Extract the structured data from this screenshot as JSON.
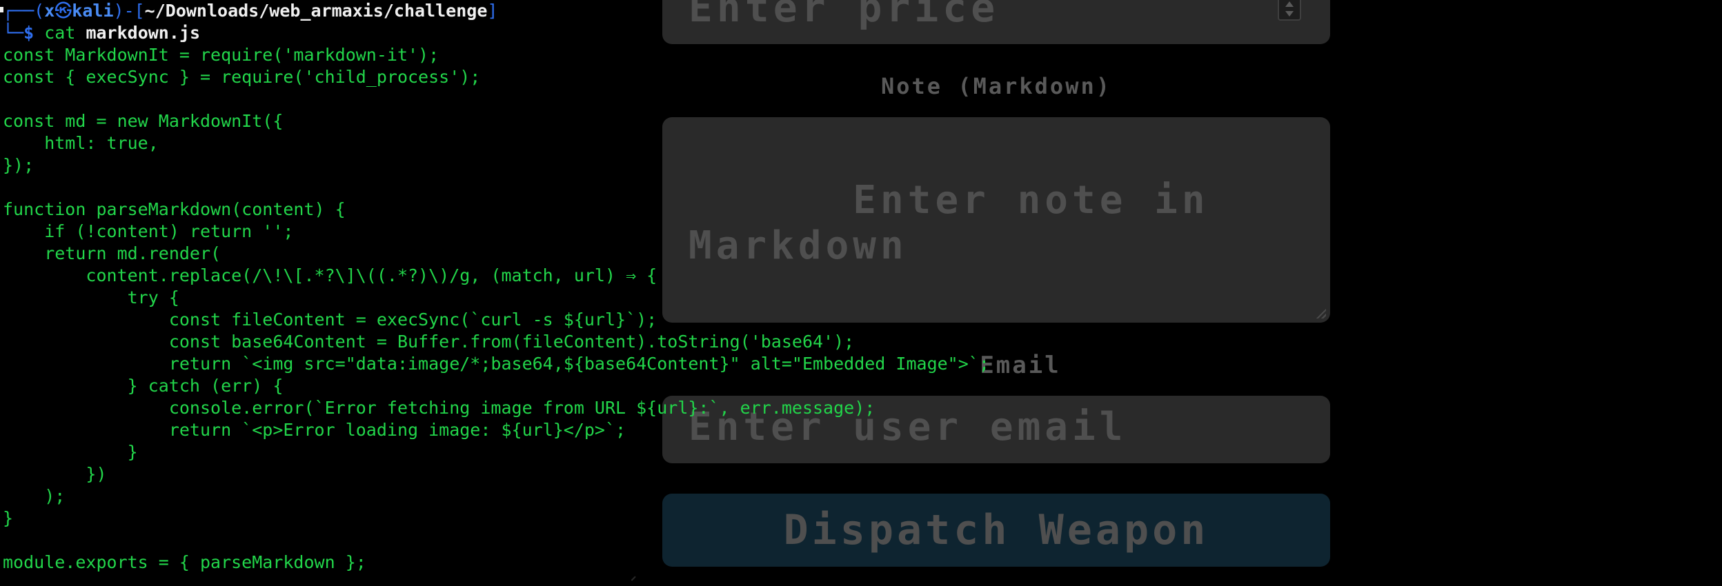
{
  "form": {
    "price_placeholder": "Enter price",
    "note_label": "Note (Markdown)",
    "note_placeholder": "Enter note in\nMarkdown",
    "email_label": "Email",
    "email_placeholder": "Enter user email",
    "submit_label": "Dispatch Weapon"
  },
  "terminal": {
    "prompt": {
      "box_left": "┌──(",
      "user": "x",
      "skull_glyph": "㉿",
      "host": "kali",
      "box_mid": ")-[",
      "path": "~/Downloads/web_armaxis/challenge",
      "box_right": "]",
      "box_bottom": "└─",
      "dollar": "$",
      "command": "cat",
      "argument": "markdown.js"
    },
    "code_lines": [
      "const MarkdownIt = require('markdown-it');",
      "const { execSync } = require('child_process');",
      "",
      "const md = new MarkdownIt({",
      "    html: true,",
      "});",
      "",
      "function parseMarkdown(content) {",
      "    if (!content) return '';",
      "    return md.render(",
      "        content.replace(/\\!\\[.*?\\]\\((.*?)\\)/g, (match, url) ⇒ {",
      "            try {",
      "                const fileContent = execSync(`curl -s ${url}`);",
      "                const base64Content = Buffer.from(fileContent).toString('base64');",
      "                return `<img src=\"data:image/*;base64,${base64Content}\" alt=\"Embedded Image\">`;",
      "            } catch (err) {",
      "                console.error(`Error fetching image from URL ${url}:`, err.message);",
      "                return `<p>Error loading image: ${url}</p>`;",
      "            }",
      "        })",
      "    );",
      "}",
      "",
      "module.exports = { parseMarkdown };"
    ]
  },
  "colors": {
    "terminal_bg": "#000000",
    "code_text": "#22d54a",
    "prompt_blue": "#2f6ff0",
    "path_white": "#f0f0f0",
    "form_field_bg": "#2a2a2a",
    "button_bg": "#0e2430",
    "placeholder_gray": "#4f4f4f"
  }
}
